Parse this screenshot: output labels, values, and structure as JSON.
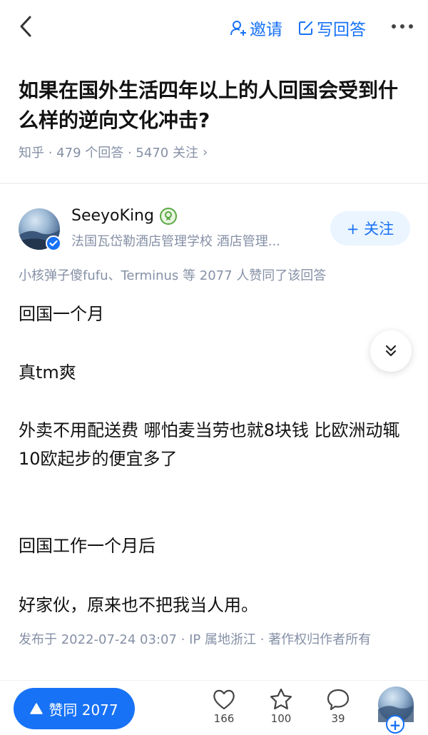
{
  "header": {
    "invite_label": "邀请",
    "write_label": "写回答"
  },
  "question": {
    "title": "如果在国外生活四年以上的人回国会受到什么样的逆向文化冲击?",
    "meta": "知乎 · 479 个回答 · 5470 关注",
    "meta_arrow": "›"
  },
  "answer": {
    "author_name": "SeeyoKing",
    "author_bio": "法国瓦岱勒酒店管理学校 酒店管理...",
    "follow_label": "+ 关注",
    "agree_line": "小核弹子傻fufu、Terminus 等 2077 人赞同了该回答",
    "paragraphs": [
      "回国一个月",
      "真tm爽",
      "外卖不用配送费 哪怕麦当劳也就8块钱 比欧洲动辄10欧起步的便宜多了",
      "回国工作一个月后",
      "好家伙，原来也不把我当人用。"
    ],
    "footnote": "发布于 2022-07-24 03:07 · IP 属地浙江 · 著作权归作者所有"
  },
  "bottom_bar": {
    "vote_label": "赞同 2077",
    "like_count": "166",
    "favorite_count": "100",
    "comment_count": "39",
    "avatar_plus": "+"
  },
  "colors": {
    "accent": "#1772f6",
    "muted": "#8590a6",
    "follow_bg": "#ebf5ff"
  }
}
